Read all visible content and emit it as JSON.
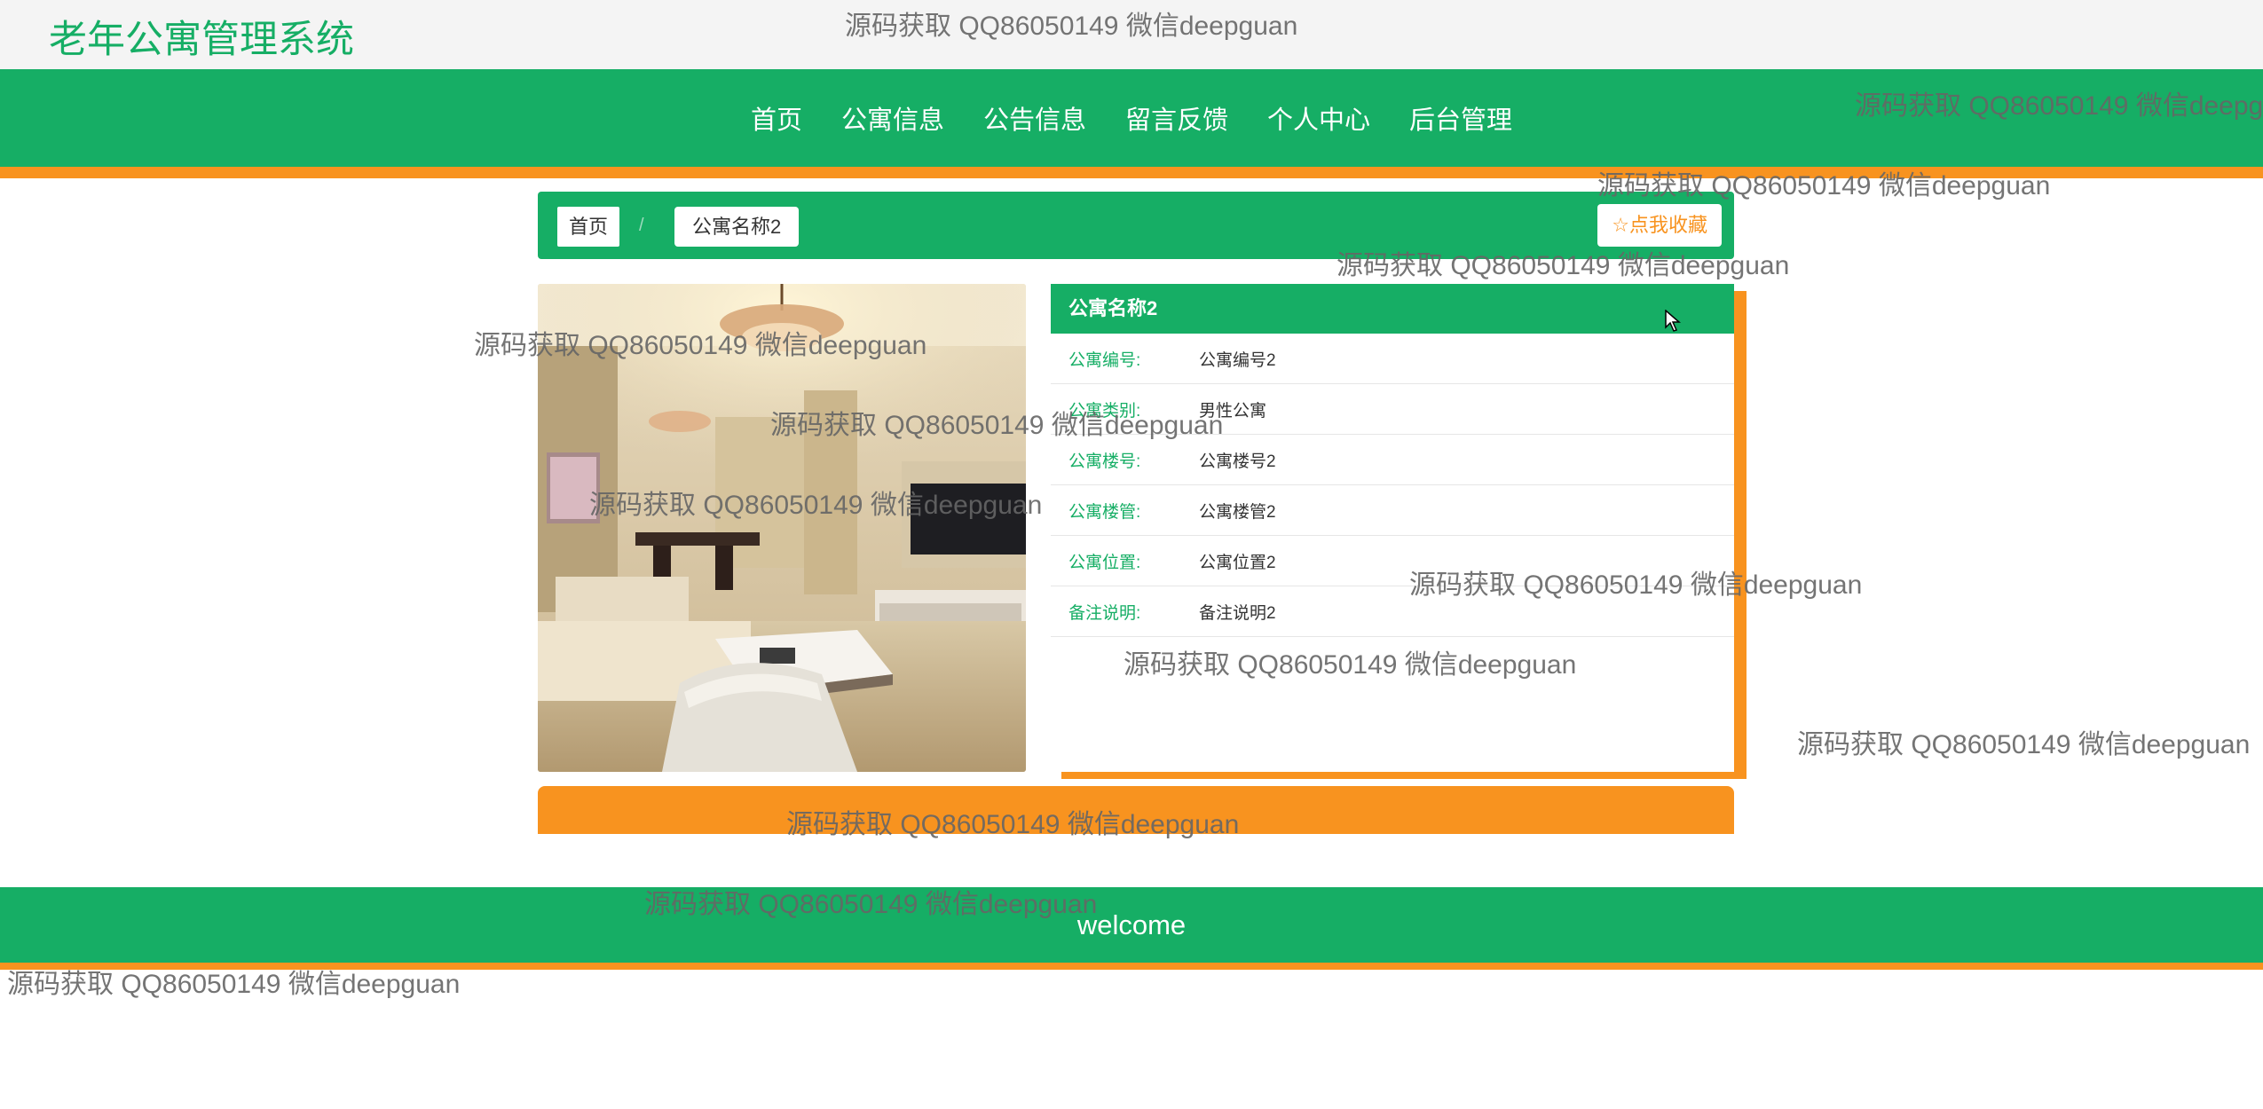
{
  "header": {
    "site_title": "老年公寓管理系统"
  },
  "nav": {
    "items": [
      {
        "label": "首页"
      },
      {
        "label": "公寓信息"
      },
      {
        "label": "公告信息"
      },
      {
        "label": "留言反馈"
      },
      {
        "label": "个人中心"
      },
      {
        "label": "后台管理"
      }
    ]
  },
  "breadcrumb": {
    "home": "首页",
    "separator": "/",
    "current": "公寓名称2"
  },
  "favorite_button": {
    "icon": "star-icon",
    "label": "点我收藏"
  },
  "detail": {
    "title": "公寓名称2",
    "rows": [
      {
        "label": "公寓编号:",
        "value": "公寓编号2"
      },
      {
        "label": "公寓类别:",
        "value": "男性公寓"
      },
      {
        "label": "公寓楼号:",
        "value": "公寓楼号2"
      },
      {
        "label": "公寓楼管:",
        "value": "公寓楼管2"
      },
      {
        "label": "公寓位置:",
        "value": "公寓位置2"
      },
      {
        "label": "备注说明:",
        "value": "备注说明2"
      }
    ]
  },
  "footer": {
    "text": "welcome"
  },
  "watermark": {
    "text": "源码获取 QQ86050149 微信deepguan"
  },
  "colors": {
    "primary": "#16ae65",
    "accent": "#f8931f"
  }
}
